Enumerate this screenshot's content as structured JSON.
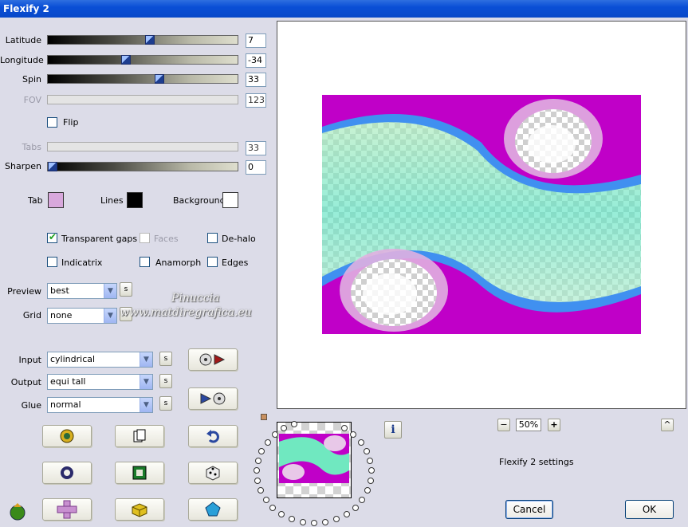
{
  "window": {
    "title": "Flexify 2"
  },
  "sliders": [
    {
      "label": "Latitude",
      "value": "7",
      "level": 0.53,
      "enabled": true
    },
    {
      "label": "Longitude",
      "value": "-34",
      "level": 0.41,
      "enabled": true
    },
    {
      "label": "Spin",
      "value": "33",
      "level": 0.59,
      "enabled": true
    },
    {
      "label": "FOV",
      "value": "123",
      "enabled": false
    },
    {
      "label": "Tabs",
      "value": "33",
      "enabled": false
    },
    {
      "label": "Sharpen",
      "value": "0",
      "level": 0.0,
      "enabled": true
    }
  ],
  "flip": {
    "label": "Flip",
    "checked": false
  },
  "colors": {
    "tab_label": "Tab",
    "tab_color": "#d8a8dc",
    "lines_label": "Lines",
    "lines_color": "#000000",
    "background_label": "Background",
    "background_color": "#ffffff"
  },
  "options": {
    "transparent_gaps": {
      "label": "Transparent gaps",
      "checked": true
    },
    "faces": {
      "label": "Faces",
      "checked": false,
      "enabled": false
    },
    "de_halo": {
      "label": "De-halo",
      "checked": false
    },
    "indicatrix": {
      "label": "Indicatrix",
      "checked": false
    },
    "anamorph": {
      "label": "Anamorph",
      "checked": false
    },
    "edges": {
      "label": "Edges",
      "checked": false
    }
  },
  "preview": {
    "label": "Preview",
    "value": "best"
  },
  "grid": {
    "label": "Grid",
    "value": "none"
  },
  "input": {
    "label": "Input",
    "value": "cylindrical"
  },
  "output": {
    "label": "Output",
    "value": "equi tall"
  },
  "glue": {
    "label": "Glue",
    "value": "normal"
  },
  "s_button_label": "s",
  "watermark": {
    "line1": "Pinuccia",
    "line2": "www.matdiregrafica.eu"
  },
  "zoom": {
    "minus": "−",
    "value": "50%",
    "plus": "+"
  },
  "info_icon": "i",
  "collapse_label": "^",
  "settings_title": "Flexify 2 settings",
  "buttons": {
    "cancel": "Cancel",
    "ok": "OK"
  }
}
